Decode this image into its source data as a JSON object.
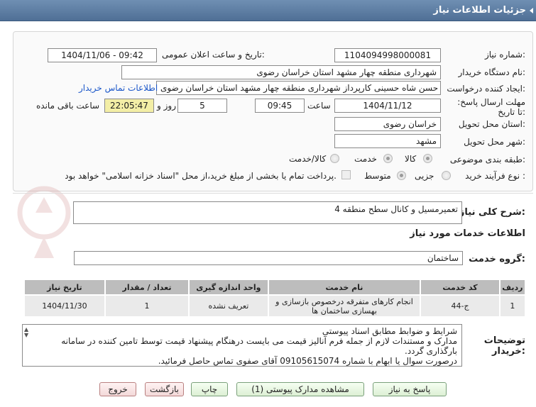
{
  "header": {
    "title": "جزئیات اطلاعات نیاز"
  },
  "form": {
    "need_number_label": "شماره نیاز:",
    "need_number": "1104094998000081",
    "announce_label": "تاریخ و ساعت اعلان عمومی:",
    "announce_value": "1404/11/06 - 09:42",
    "buyer_org_label": "نام دستگاه خریدار:",
    "buyer_org": "شهرداری منطقه چهار مشهد استان خراسان رضوی",
    "creator_label": "ایجاد کننده درخواست:",
    "creator": "حسن شاه حسینی کارپرداز شهرداری منطقه چهار مشهد استان خراسان رضوی",
    "contact_link": "اطلاعات تماس خریدار",
    "deadline_label": "مهلت ارسال پاسخ: تا تاریخ:",
    "deadline_date": "1404/11/12",
    "time_label": "ساعت",
    "deadline_time": "09:45",
    "days_value": "5",
    "days_label": "روز و",
    "remaining_time": "22:05:47",
    "remaining_label": "ساعت باقی مانده",
    "province_label": "استان محل تحویل:",
    "province": "خراسان رضوی",
    "city_label": "شهر محل تحویل:",
    "city": "مشهد",
    "category_label": "طبقه بندی موضوعی:",
    "category_options": [
      "کالا",
      "خدمت",
      "کالا/خدمت"
    ],
    "process_label": "نوع فرآیند خرید :",
    "process_options": [
      "جزیی",
      "متوسط"
    ],
    "payment_note": "پرداخت تمام یا بخشی از مبلغ خرید،از محل \"اسناد خزانه اسلامی\" خواهد بود."
  },
  "summary": {
    "label": "شرح کلی نیاز:",
    "value": "تعمیرمسیل و کانال سطح منطقه 4"
  },
  "services": {
    "section_title": "اطلاعات خدمات مورد نیاز",
    "group_label": "گروه خدمت:",
    "group_value": "ساختمان",
    "columns": [
      "ردیف",
      "کد خدمت",
      "نام خدمت",
      "واحد اندازه گیری",
      "تعداد / مقدار",
      "تاریخ نیاز"
    ],
    "rows": [
      [
        "1",
        "ج-44",
        "انجام کارهای متفرقه درخصوص بازسازی و بهسازی ساختمان ها",
        "تعریف نشده",
        "1",
        "1404/11/30"
      ]
    ]
  },
  "buyer_notes": {
    "label": "توضیحات خریدار:",
    "lines": [
      "شرایط و ضوابط مطابق اسناد پیوستی",
      "مدارک و مستندات لازم از جمله فرم آنالیز قیمت می بایست درهنگام پیشنهاد قیمت توسط تامین کننده در سامانه بارگذاری گردد.",
      "درصورت سوال یا ابهام با شماره 09105615074 آقای صفوی تماس حاصل فرمائید."
    ]
  },
  "buttons": {
    "reply": "پاسخ به نیاز",
    "view_docs": "مشاهده مدارک پیوستی (1)",
    "print": "چاپ",
    "back": "بازگشت",
    "exit": "خروج"
  }
}
